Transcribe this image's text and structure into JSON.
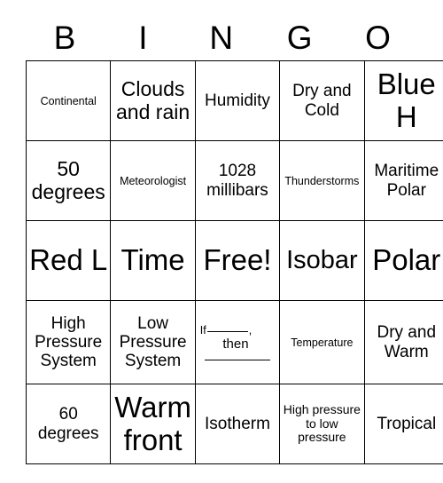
{
  "card": {
    "title": "BINGO",
    "headers": [
      "B",
      "I",
      "N",
      "G",
      "O"
    ],
    "rows": [
      [
        {
          "text": "Continental",
          "size": "xs"
        },
        {
          "text": "Clouds and rain",
          "size": "lg"
        },
        {
          "text": "Humidity",
          "size": "md"
        },
        {
          "text": "Dry and Cold",
          "size": "md"
        },
        {
          "text": "Blue H",
          "size": "xxl"
        }
      ],
      [
        {
          "text": "50 degrees",
          "size": "lg"
        },
        {
          "text": "Meteorologist",
          "size": "xs"
        },
        {
          "text": "1028 millibars",
          "size": "md"
        },
        {
          "text": "Thunderstorms",
          "size": "xs"
        },
        {
          "text": "Maritime Polar",
          "size": "md"
        }
      ],
      [
        {
          "text": "Red L",
          "size": "xxl"
        },
        {
          "text": "Time",
          "size": "xxl"
        },
        {
          "text": "Free!",
          "size": "xxl"
        },
        {
          "text": "Isobar",
          "size": "xl"
        },
        {
          "text": "Polar",
          "size": "xxl"
        }
      ],
      [
        {
          "text": "High Pressure System",
          "size": "md"
        },
        {
          "text": "Low Pressure System",
          "size": "md"
        },
        {
          "type": "fill-in-blank",
          "prefix": "If",
          "comma": ",",
          "then": "then",
          "size": "xs"
        },
        {
          "text": "Temperature",
          "size": "xs"
        },
        {
          "text": "Dry and Warm",
          "size": "md"
        }
      ],
      [
        {
          "text": "60 degrees",
          "size": "md"
        },
        {
          "text": "Warm front",
          "size": "xxl"
        },
        {
          "text": "Isotherm",
          "size": "md"
        },
        {
          "text": "High pressure to low pressure",
          "size": "sm"
        },
        {
          "text": "Tropical",
          "size": "md"
        }
      ]
    ]
  },
  "colors": {
    "background": "#ffffff",
    "text": "#000000",
    "border": "#000000"
  }
}
